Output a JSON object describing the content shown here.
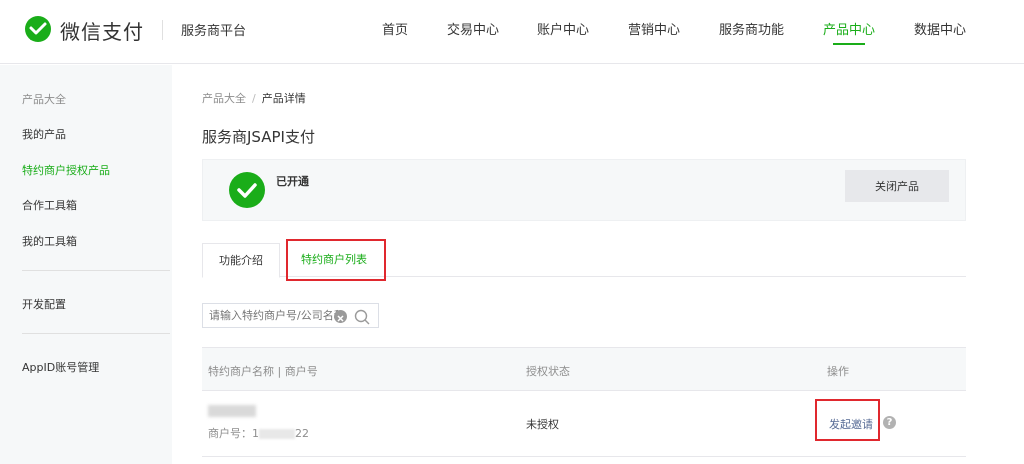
{
  "header": {
    "brand": "微信支付",
    "platform": "服务商平台",
    "nav": [
      "首页",
      "交易中心",
      "账户中心",
      "营销中心",
      "服务商功能",
      "产品中心",
      "数据中心"
    ],
    "active_nav": "产品中心",
    "accent_color": "#1aad19"
  },
  "sidebar": {
    "section_label": "产品大全",
    "items": [
      "我的产品",
      "特约商户授权产品",
      "合作工具箱",
      "我的工具箱",
      "开发配置",
      "AppID账号管理"
    ],
    "active_item": "特约商户授权产品"
  },
  "main": {
    "breadcrumb": [
      "产品大全",
      "产品详情"
    ],
    "breadcrumb_sep": "/",
    "title": "服务商JSAPI支付",
    "status": {
      "text": "已开通",
      "icon": "check-circle-icon",
      "close_button": "关闭产品"
    },
    "tabs": [
      "功能介绍",
      "特约商户列表"
    ],
    "active_tab": "特约商户列表",
    "search": {
      "placeholder": "请输入特约商户号/公司名称"
    },
    "table": {
      "columns": [
        "特约商户名称 | 商户号",
        "授权状态",
        "操作"
      ],
      "rows": [
        {
          "merchant_id_prefix": "商户号：1",
          "merchant_id_suffix": "22",
          "auth_status": "未授权",
          "action": "发起邀请"
        }
      ]
    },
    "highlight_color": "#e0282e"
  }
}
